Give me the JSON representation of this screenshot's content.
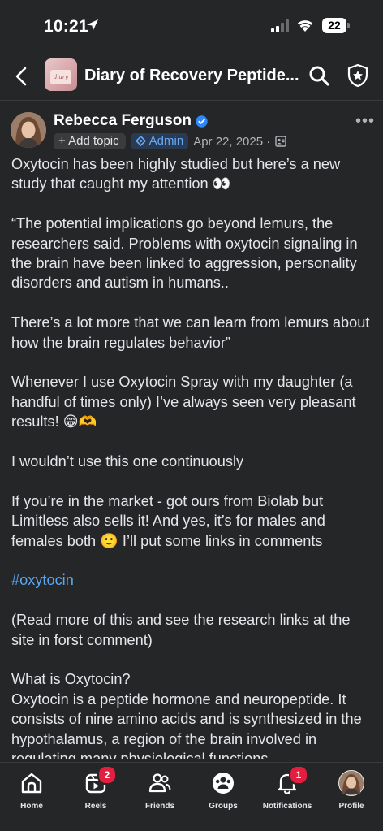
{
  "status_bar": {
    "time": "10:21",
    "battery": "22"
  },
  "header": {
    "group_title": "Diary of Recovery Peptide...",
    "group_thumb_text": "diary"
  },
  "post": {
    "author": "Rebecca Ferguson",
    "add_topic": "+ Add topic",
    "admin_label": "Admin",
    "date": "Apr 22, 2025 ·",
    "paragraphs": [
      "Oxytocin has been highly studied but here’s a new study that caught my attention 👀",
      "“The potential implications go beyond lemurs, the researchers said. Problems with oxytocin signaling in the brain have been linked to aggression, personality disorders and autism in humans..",
      "There’s a lot more that we can learn from lemurs about how the brain regulates behavior”",
      "Whenever I use Oxytocin Spray with my daughter (a handful of times only) I’ve always seen very pleasant results! 😁🫶",
      "I wouldn’t use this one continuously",
      "If you’re in the market - got ours from Biolab but Limitless also sells it!  And yes, it’s for males and females both 🙂  I’ll put some links in comments"
    ],
    "hashtag": "#oxytocin",
    "paragraphs_after": [
      "(Read more of this and see the research links at the site in forst comment)"
    ],
    "what_is_heading": "What is Oxytocin?",
    "what_is_text_start": "Oxytocin is a peptide hormone and neuropeptide. It consists of nine amino acids and is synthesized in the hypothalamus, a region of the brain involved in regulating many physio",
    "what_is_text_underlined": "logical fu",
    "what_is_text_end": "nctions."
  },
  "tabbar": {
    "items": [
      {
        "label": "Home",
        "icon": "home-icon"
      },
      {
        "label": "Reels",
        "icon": "reels-icon",
        "badge": "2"
      },
      {
        "label": "Friends",
        "icon": "friends-icon"
      },
      {
        "label": "Groups",
        "icon": "groups-icon"
      },
      {
        "label": "Notifications",
        "icon": "bell-icon",
        "badge": "1"
      },
      {
        "label": "Profile",
        "icon": "profile-avatar"
      }
    ]
  },
  "colors": {
    "background": "#252628",
    "link": "#5aa7f2",
    "verified": "#2d88ff",
    "badge": "#e41e3f"
  }
}
